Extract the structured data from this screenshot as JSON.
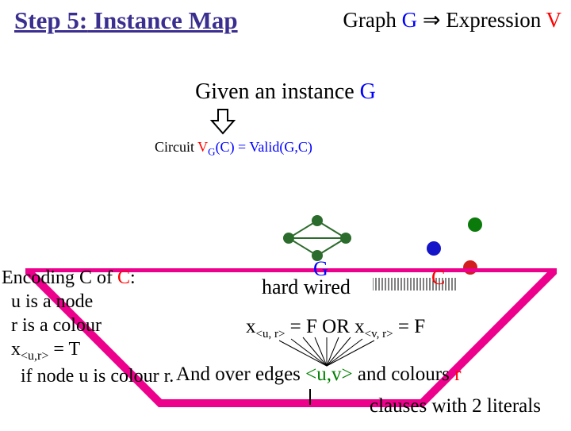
{
  "title": {
    "step": "Step 5:",
    "rest": " Instance Map"
  },
  "titleRight": {
    "prefix": "Graph ",
    "g": "G",
    "implies": " ⇒ Expression ",
    "v": "V"
  },
  "given": {
    "prefix": "Given an instance ",
    "g": "G"
  },
  "circuit": {
    "label": "Circuit ",
    "vg": "V",
    "gsub": "G",
    "rest": "(C) = Valid(G,C)"
  },
  "encoding": {
    "line1_a": "Encoding C of ",
    "line1_b": "C",
    "line1_c": ":",
    "line2": "  u is a node",
    "line3": "  r is a colour",
    "line4_a": "  x",
    "line4_sub": "<u,r>",
    "line4_b": " = T",
    "line5": "    if node u is colour r."
  },
  "labels": {
    "g": "G",
    "hardwired": "hard wired",
    "c": "C"
  },
  "formula": {
    "x1": "x",
    "sub1": "<u, r>",
    "mid": " = F OR ",
    "x2": "x",
    "sub2": "<v, r>",
    "end": " = F"
  },
  "andline": {
    "prefix": "And over edges ",
    "uv": "<u,v>",
    "mid": " and colours ",
    "r": "r"
  },
  "clauses": "clauses with 2 literals",
  "colors": {
    "title": "#3a2f8f",
    "blue": "#0000ff",
    "red": "#ff0000",
    "green": "#008000",
    "magenta": "#ec008c",
    "darkgreen": "#2b6b2b",
    "dotgreen": "#0a7a0a",
    "dotblue": "#1414c8",
    "dotred": "#d21e1e"
  }
}
